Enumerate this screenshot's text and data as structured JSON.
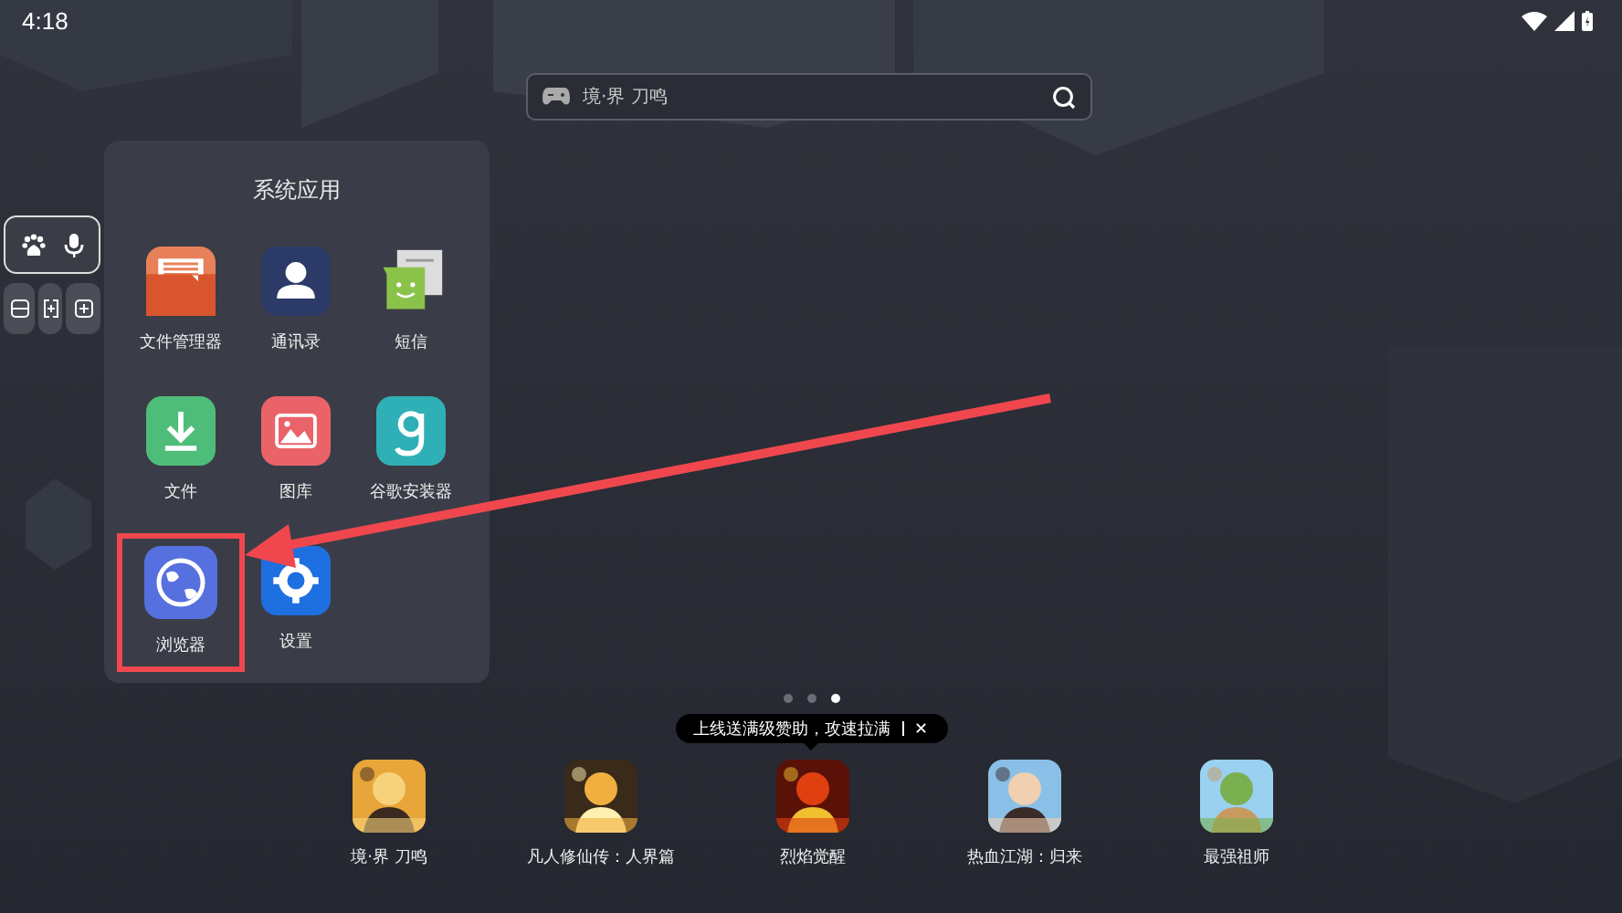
{
  "status_bar": {
    "time": "4:18"
  },
  "search": {
    "placeholder": "境·界 刀鸣"
  },
  "folder": {
    "title": "系统应用",
    "apps": [
      {
        "label": "文件管理器",
        "highlighted": false
      },
      {
        "label": "通讯录",
        "highlighted": false
      },
      {
        "label": "短信",
        "highlighted": false
      },
      {
        "label": "文件",
        "highlighted": false
      },
      {
        "label": "图库",
        "highlighted": false
      },
      {
        "label": "谷歌安装器",
        "highlighted": false
      },
      {
        "label": "浏览器",
        "highlighted": true
      },
      {
        "label": "设置",
        "highlighted": false
      }
    ]
  },
  "page_dots": [
    {
      "selected": false
    },
    {
      "selected": false
    },
    {
      "selected": true
    }
  ],
  "tooltip": {
    "text": "上线送满级赞助，攻速拉满",
    "close": "✕"
  },
  "dock": [
    {
      "label": "境·界 刀鸣",
      "kind": "picture"
    },
    {
      "label": "凡人修仙传：人界篇",
      "kind": "picture"
    },
    {
      "label": "烈焰觉醒",
      "kind": "picture"
    },
    {
      "label": "热血江湖：归来",
      "kind": "picture"
    },
    {
      "label": "最强祖师",
      "kind": "picture"
    }
  ]
}
